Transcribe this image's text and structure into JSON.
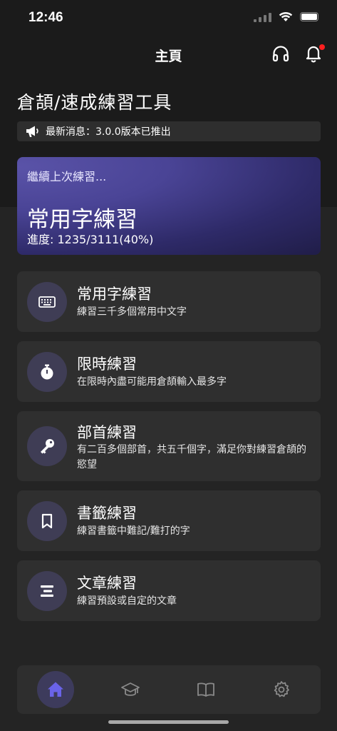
{
  "status_bar": {
    "time": "12:46"
  },
  "header": {
    "title": "主頁",
    "headphones_icon": "headphones-icon",
    "bell_icon": "bell-icon",
    "notification_color": "#ff1f1f"
  },
  "app": {
    "title": "倉頡/速成練習工具",
    "news": "最新消息：3.0.0版本已推出",
    "news_icon": "megaphone-icon"
  },
  "continue_card": {
    "label": "繼續上次練習...",
    "title": "常用字練習",
    "progress": "進度: 1235/3111(40%)",
    "progress_value": 0.4
  },
  "practice_cards": [
    {
      "icon": "keyboard-icon",
      "title": "常用字練習",
      "desc": "練習三千多個常用中文字"
    },
    {
      "icon": "stopwatch-icon",
      "title": "限時練習",
      "desc": "在限時內盡可能用倉頡輸入最多字"
    },
    {
      "icon": "key-icon",
      "title": "部首練習",
      "desc": "有二百多個部首，共五千個字，滿足你對練習倉頡的慾望"
    },
    {
      "icon": "bookmark-icon",
      "title": "書籤練習",
      "desc": "練習書籤中難記/難打的字"
    },
    {
      "icon": "text-lines-icon",
      "title": "文章練習",
      "desc": "練習預設或自定的文章"
    }
  ],
  "tab_bar": {
    "tabs": [
      "home-icon",
      "graduation-cap-icon",
      "book-icon",
      "gear-icon"
    ],
    "active_color": "#6a63e8"
  }
}
